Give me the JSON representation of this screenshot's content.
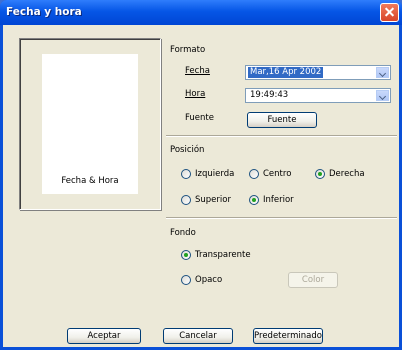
{
  "window": {
    "title": "Fecha y hora"
  },
  "preview": {
    "label": "Fecha & Hora"
  },
  "formato": {
    "heading": "Formato",
    "fecha_label": "Fecha",
    "fecha_value": "Mar,16 Apr 2002",
    "hora_label": "Hora",
    "hora_value": "19:49:43",
    "fuente_label": "Fuente",
    "fuente_button": "Fuente"
  },
  "posicion": {
    "heading": "Posición",
    "options": [
      {
        "label": "Izquierda",
        "checked": false
      },
      {
        "label": "Centro",
        "checked": false
      },
      {
        "label": "Derecha",
        "checked": true
      },
      {
        "label": "Superior",
        "checked": false
      },
      {
        "label": "Inferior",
        "checked": true
      }
    ]
  },
  "fondo": {
    "heading": "Fondo",
    "transparente_label": "Transparente",
    "transparente_checked": true,
    "opaco_label": "Opaco",
    "opaco_checked": false,
    "color_button": "Color"
  },
  "buttons": {
    "aceptar": "Aceptar",
    "cancelar": "Cancelar",
    "predeterminado": "Predeterminado"
  },
  "colors": {
    "titlebar": "#0656e6",
    "dialog_bg": "#ece9d8",
    "selection": "#316ac5",
    "radio_dot": "#21a121"
  }
}
